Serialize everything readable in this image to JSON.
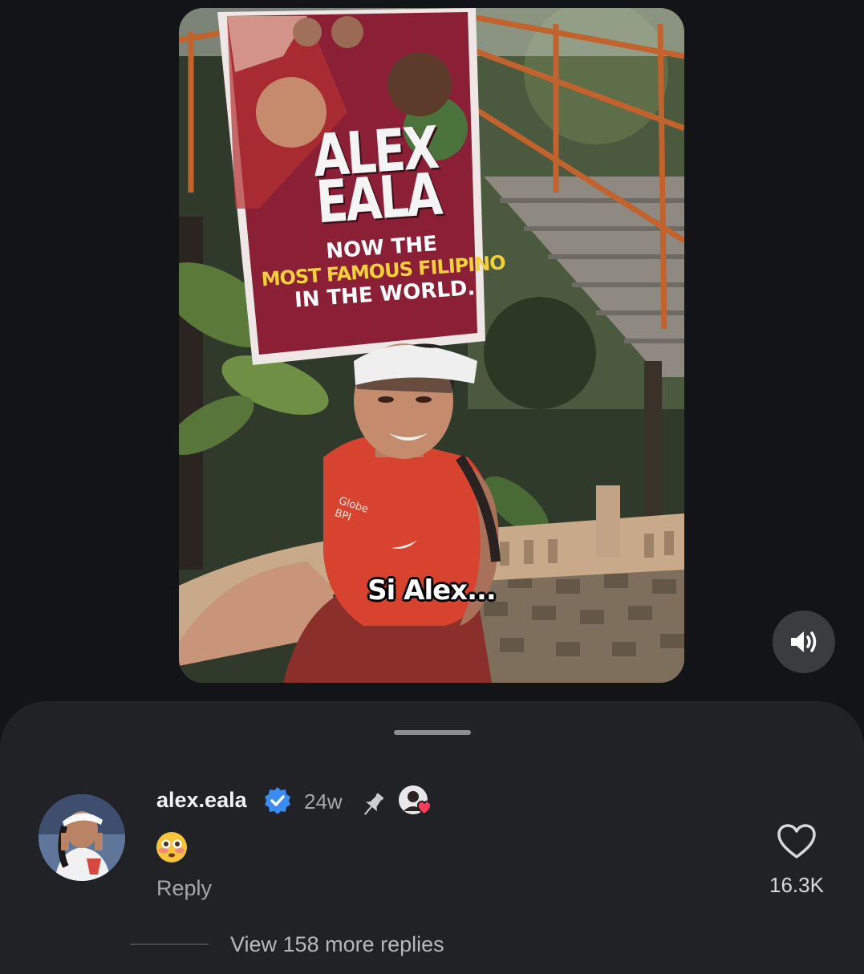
{
  "video": {
    "caption": "Si Alex...",
    "banner": {
      "name_line1": "ALEX",
      "name_line2": "EALA",
      "tagline1": "NOW THE",
      "tagline2": "MOST FAMOUS FILIPINO",
      "tagline3": "IN THE WORLD."
    },
    "shirt_sponsor1": "Globe",
    "shirt_sponsor2": "BPI",
    "mute_icon": "speaker-volume-icon"
  },
  "comment": {
    "username": "alex.eala",
    "verified_icon": "verified-badge-icon",
    "time": "24w",
    "pinned_icon": "pin-icon",
    "liked_by_creator_icon": "creator-heart-icon",
    "emoji_text": "😳",
    "reply_label": "Reply",
    "like_icon": "heart-outline-icon",
    "like_count": "16.3K",
    "view_replies_label": "View 158 more replies"
  },
  "colors": {
    "background": "#121418",
    "sheet": "#212226",
    "verified_blue": "#3b8cf0",
    "muted_text": "#a6a7ab",
    "banner_maroon": "#8a1f35",
    "banner_yellow": "#f3cf3a",
    "statue_red": "#d8432f"
  }
}
